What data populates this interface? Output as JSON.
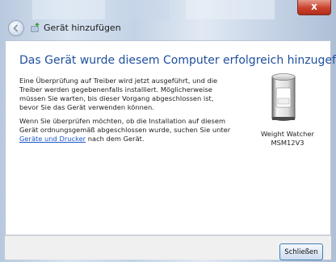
{
  "window": {
    "title": "Gerät hinzufügen",
    "close_glyph": "x"
  },
  "main": {
    "headline": "Das Gerät wurde diesem Computer erfolgreich hinzugefügt.",
    "paragraph1": "Eine Überprüfung auf Treiber wird jetzt ausgeführt, und die Treiber werden gegebenenfalls installiert. Möglicherweise müssen Sie warten, bis dieser Vorgang abgeschlossen ist, bevor Sie das Gerät verwenden können.",
    "paragraph2_prefix": "Wenn Sie überprüfen möchten, ob die Installation auf diesem Gerät ordnungsgemäß abgeschlossen wurde, suchen Sie unter ",
    "paragraph2_link": "Geräte und Drucker",
    "paragraph2_suffix": " nach dem Gerät."
  },
  "device": {
    "name_line1": "Weight Watcher",
    "name_line2": "MSM12V3",
    "icon": "device-icon"
  },
  "footer": {
    "close_label": "Schließen"
  },
  "colors": {
    "headline": "#1e4f9c",
    "link": "#1c55c8",
    "close_button": "#c8412d"
  }
}
